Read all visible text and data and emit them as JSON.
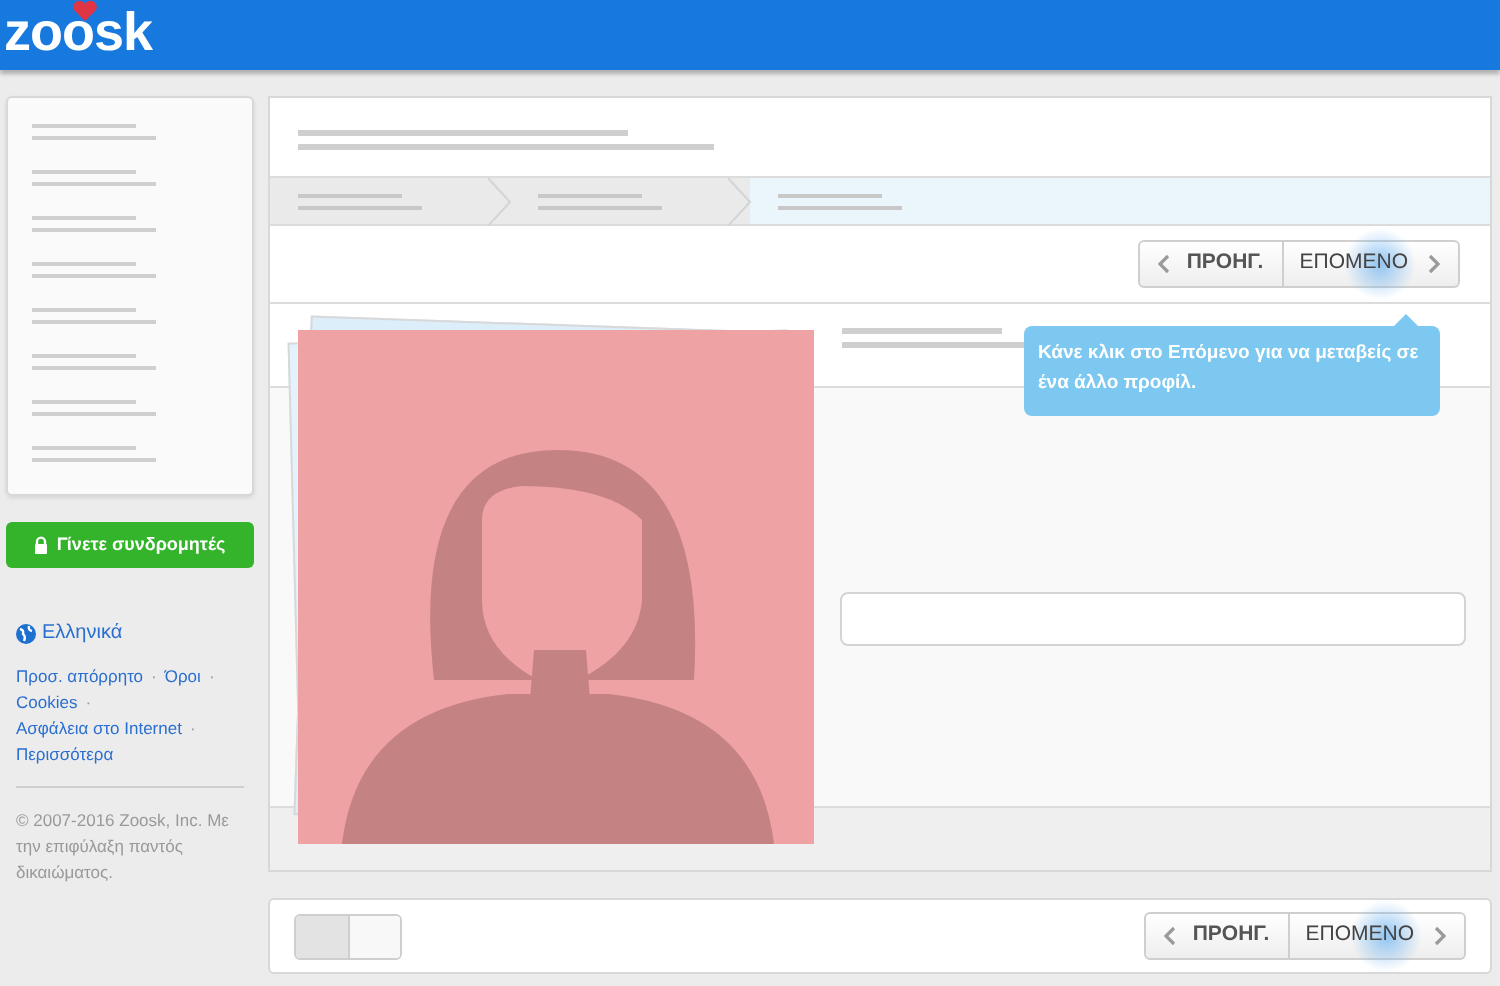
{
  "header": {
    "logo": "zoosk"
  },
  "sidebar": {
    "nav_items": [
      {
        "selected": false
      },
      {
        "selected": false
      },
      {
        "selected": false
      },
      {
        "selected": false
      },
      {
        "selected": false
      },
      {
        "selected": false
      },
      {
        "selected": false
      },
      {
        "selected": false
      }
    ],
    "subscribe_button": "Γίνετε συνδρομητές",
    "language": "Ελληνικά",
    "separator": "·",
    "links": [
      "Προσ. απόρρητο",
      "Όροι",
      "Cookies",
      "Ασφάλεια στο Internet",
      "Περισσότερα"
    ],
    "copyright": "© 2007-2016 Zoosk, Inc. Με την επιφύλαξη παντός δικαιώματος."
  },
  "steps": [
    {
      "selected": false
    },
    {
      "selected": false
    },
    {
      "selected": true
    }
  ],
  "pager": {
    "prev": "ΠΡΟΗΓ.",
    "next": "ΕΠΟΜΕΝΟ",
    "highlighted": true
  },
  "tooltip": {
    "text": "Κάνε κλικ στο Επόμενο για να μεταβείς σε ένα άλλο προφίλ."
  },
  "bottom_pager": {
    "prev": "ΠΡΟΗΓ.",
    "next": "ΕΠΟΜΕΝΟ",
    "highlighted": true
  },
  "view_toggle": [
    {
      "selected": true
    },
    {
      "selected": false
    }
  ]
}
